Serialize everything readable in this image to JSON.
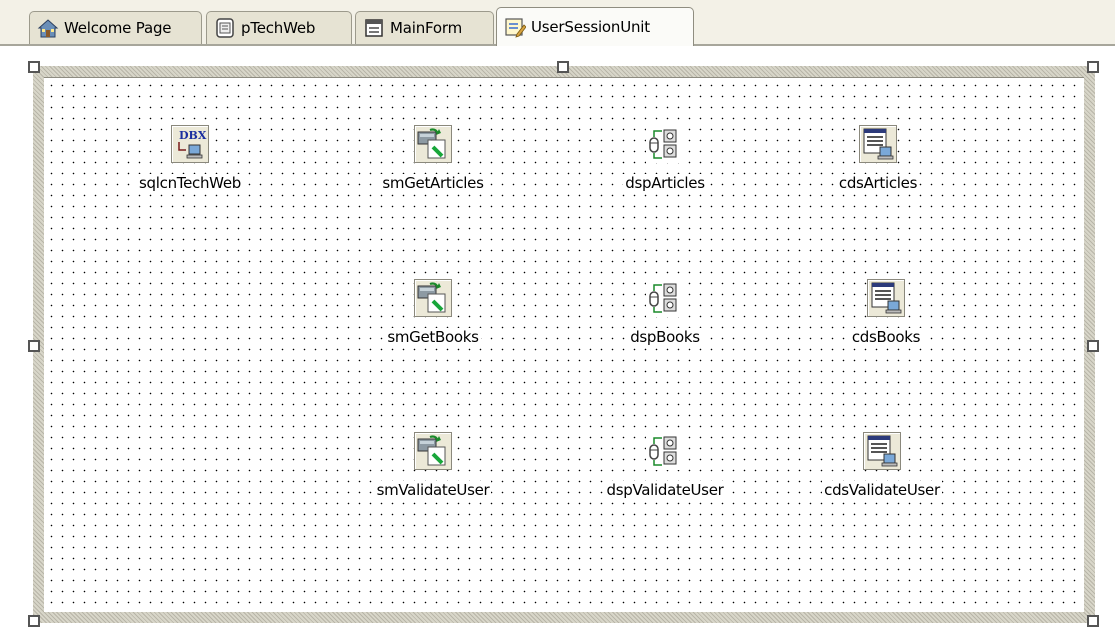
{
  "tabs": [
    {
      "label": "Welcome Page",
      "icon": "home-icon"
    },
    {
      "label": "pTechWeb",
      "icon": "project-icon"
    },
    {
      "label": "MainForm",
      "icon": "form-icon"
    },
    {
      "label": "UserSessionUnit",
      "icon": "datamodule-icon",
      "active": true
    }
  ],
  "components": {
    "c1": {
      "label": "sqlcnTechWeb",
      "icon": "dbx-connection-icon",
      "icon_text": "DBX"
    },
    "c2": {
      "label": "smGetArticles",
      "icon": "sql-server-method-icon"
    },
    "c3": {
      "label": "dspArticles",
      "icon": "dataset-provider-icon"
    },
    "c4": {
      "label": "cdsArticles",
      "icon": "client-dataset-icon"
    },
    "c5": {
      "label": "smGetBooks",
      "icon": "sql-server-method-icon"
    },
    "c6": {
      "label": "dspBooks",
      "icon": "dataset-provider-icon"
    },
    "c7": {
      "label": "cdsBooks",
      "icon": "client-dataset-icon"
    },
    "c8": {
      "label": "smValidateUser",
      "icon": "sql-server-method-icon"
    },
    "c9": {
      "label": "dspValidateUser",
      "icon": "dataset-provider-icon"
    },
    "c10": {
      "label": "cdsValidateUser",
      "icon": "client-dataset-icon"
    }
  },
  "colors": {
    "tab_strip": "#f3f1e7",
    "frame_hatch": "#cdcabb",
    "grid_dot": "#000000"
  }
}
